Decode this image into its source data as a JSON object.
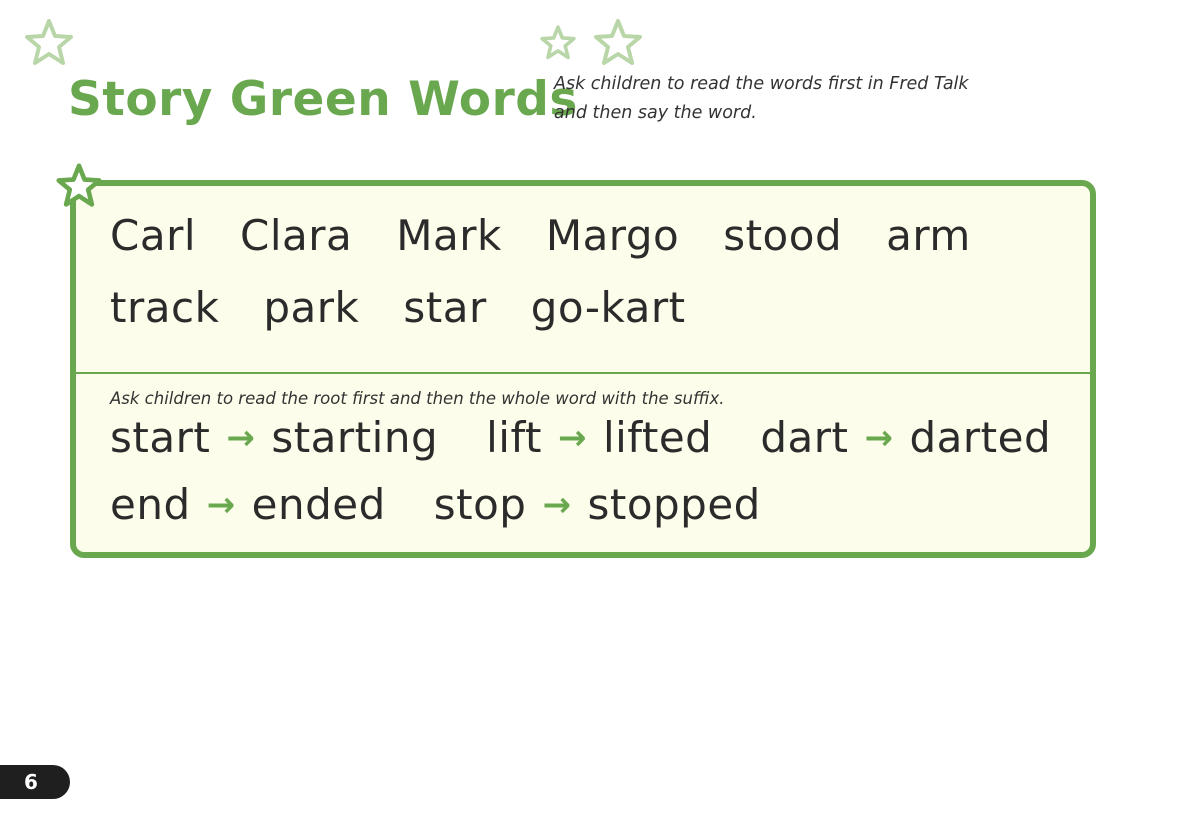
{
  "header": {
    "title": "Story Green Words",
    "instruction_lines": [
      "Ask children to read the words first in Fred Talk",
      "and then say the word."
    ]
  },
  "green_words": {
    "row1": [
      "Carl",
      "Clara",
      "Mark",
      "Margo",
      "stood",
      "arm"
    ],
    "row2": [
      "track",
      "park",
      "star",
      "go-kart"
    ]
  },
  "suffix_section": {
    "instruction": "Ask children to read the root first and then the whole word with the suffix.",
    "arrow": "→",
    "row1": [
      {
        "root": "start",
        "word": "starting"
      },
      {
        "root": "lift",
        "word": "lifted"
      },
      {
        "root": "dart",
        "word": "darted"
      }
    ],
    "row2": [
      {
        "root": "end",
        "word": "ended"
      },
      {
        "root": "stop",
        "word": "stopped"
      }
    ]
  },
  "page_number": "6",
  "colors": {
    "accent_green": "#6aa84f",
    "panel_background": "#fdfdeb",
    "star_outline": "#b9d6a8"
  }
}
